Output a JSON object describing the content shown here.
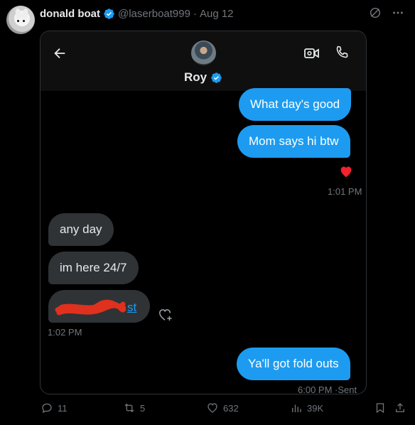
{
  "tweet": {
    "author_name": "donald boat",
    "handle": "@laserboat999",
    "separator": "·",
    "date": "Aug 12"
  },
  "dm": {
    "contact_name": "Roy",
    "messages": [
      {
        "text": "What day's good",
        "dir": "out"
      },
      {
        "text": "Mom says hi btw",
        "dir": "out"
      },
      {
        "text": "any day",
        "dir": "in"
      },
      {
        "text": "im here 24/7",
        "dir": "in"
      },
      {
        "text": "st",
        "dir": "in"
      },
      {
        "text": "Ya'll got fold outs",
        "dir": "out"
      }
    ],
    "timestamps": {
      "t1": "1:01 PM",
      "t2": "1:02 PM",
      "t3": "6:00 PM",
      "sent": "·Sent"
    },
    "reaction": "❤️"
  },
  "actions": {
    "replies": "11",
    "reposts": "5",
    "likes": "632",
    "views": "39K"
  },
  "colors": {
    "accent": "#1d9bf0",
    "incoming_bubble": "#2f3336",
    "muted": "#71767b"
  },
  "icons": [
    "verified-badge-icon",
    "grok-icon",
    "more-icon",
    "back-arrow-icon",
    "video-call-icon",
    "phone-icon",
    "add-reaction-icon",
    "reply-icon",
    "repost-icon",
    "like-icon",
    "views-icon",
    "bookmark-icon",
    "share-icon"
  ]
}
